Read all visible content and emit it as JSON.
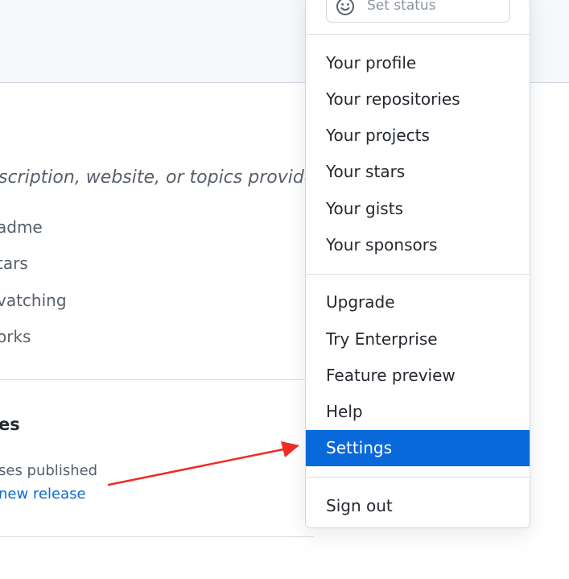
{
  "background": {
    "description_text": "scription, website, or topics provided",
    "sidebar_links": [
      "adme",
      "tars",
      "vatching",
      "orks"
    ],
    "section_title": "es",
    "release_status": "ses published",
    "release_link": "new release"
  },
  "dropdown": {
    "set_status_label": "Set status",
    "profile_group": [
      "Your profile",
      "Your repositories",
      "Your projects",
      "Your stars",
      "Your gists",
      "Your sponsors"
    ],
    "misc_group": [
      "Upgrade",
      "Try Enterprise",
      "Feature preview",
      "Help"
    ],
    "settings_label": "Settings",
    "sign_out_label": "Sign out"
  },
  "colors": {
    "accent": "#0969da",
    "annotation_arrow": "#ee2d24",
    "header_bg": "#f6f8fa"
  },
  "icons": {
    "set_status": "smiley-icon"
  }
}
